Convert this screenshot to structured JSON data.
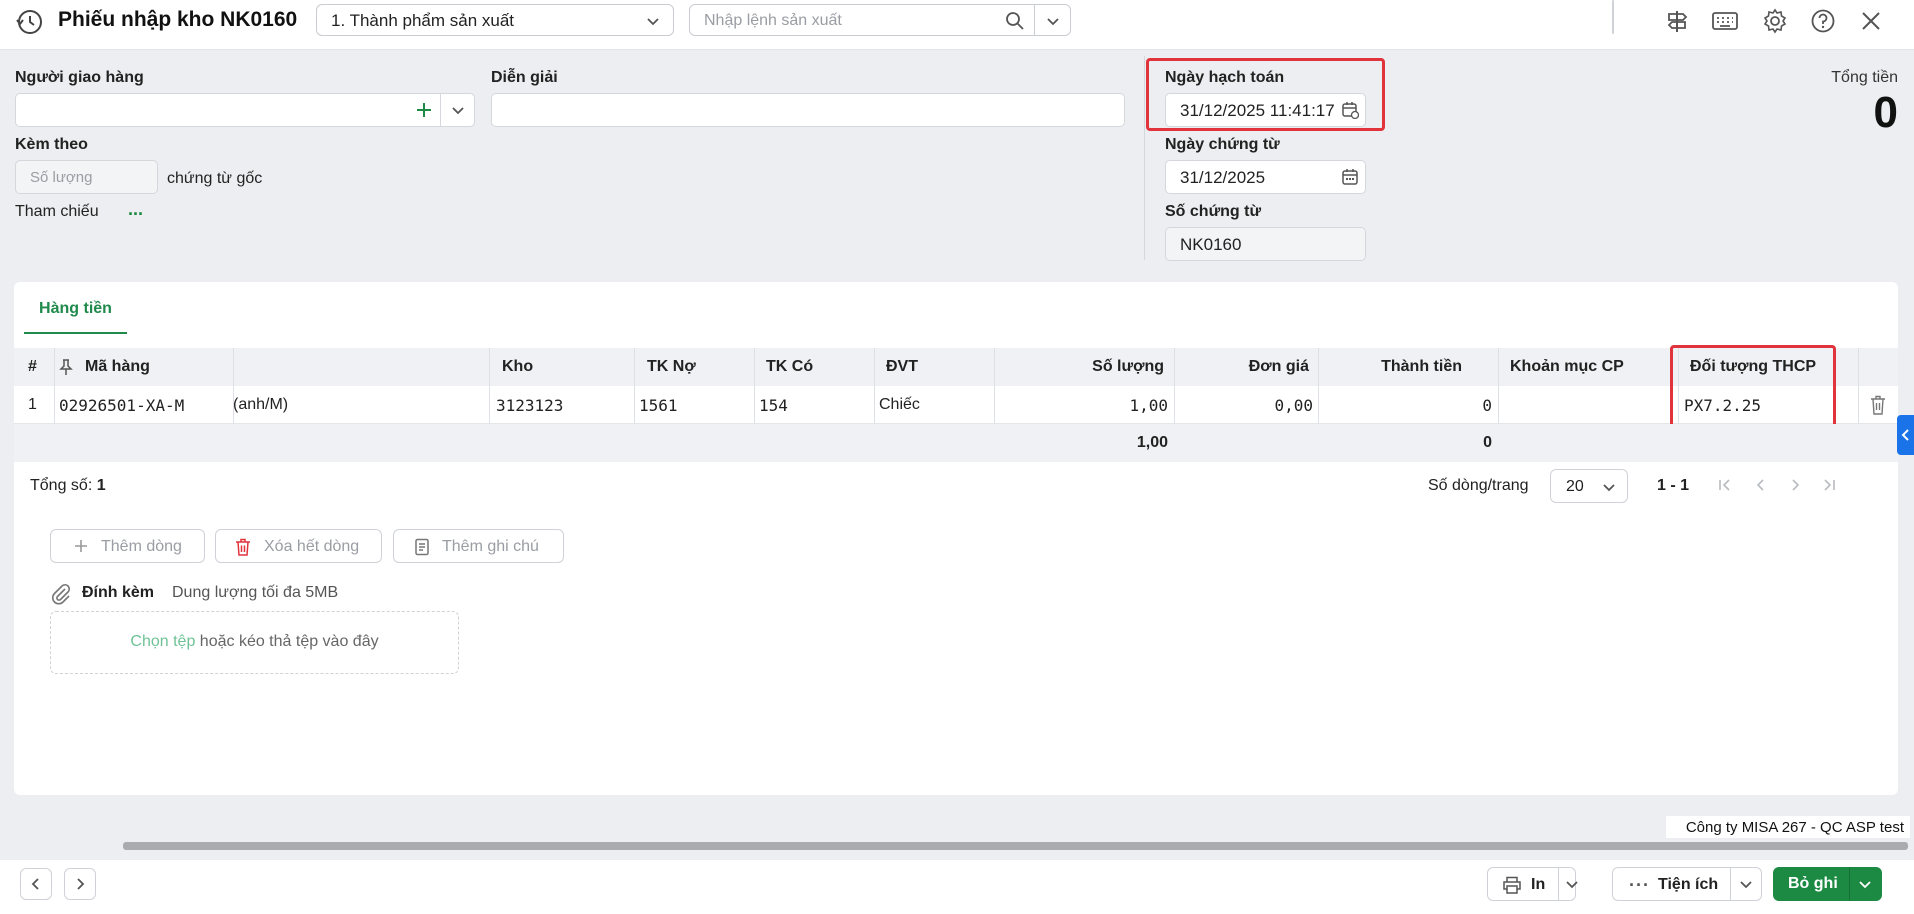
{
  "header": {
    "title": "Phiếu nhập kho NK0160",
    "type_select": "1. Thành phẩm sản xuất",
    "production_placeholder": "Nhập lệnh sản xuất"
  },
  "form": {
    "nguoi_giao_hang_label": "Người giao hàng",
    "nguoi_giao_hang_value": "",
    "dien_giai_label": "Diễn giải",
    "dien_giai_value": "",
    "kem_theo_label": "Kèm theo",
    "so_luong_placeholder": "Số lượng",
    "chung_tu_goc": "chứng từ gốc",
    "tham_chieu_label": "Tham chiếu",
    "tham_chieu_link": "...",
    "ngay_hach_toan_label": "Ngày hạch toán",
    "ngay_hach_toan_value": "31/12/2025 11:41:17",
    "ngay_chung_tu_label": "Ngày chứng từ",
    "ngay_chung_tu_value": "31/12/2025",
    "so_chung_tu_label": "Số chứng từ",
    "so_chung_tu_value": "NK0160",
    "tong_tien_label": "Tổng tiền",
    "tong_tien_value": "0"
  },
  "tabs": [
    {
      "label": "Hàng tiền"
    }
  ],
  "table": {
    "headers": {
      "num": "#",
      "ma_hang": "Mã hàng",
      "kho": "Kho",
      "tk_no": "TK Nợ",
      "tk_co": "TK Có",
      "dvt": "ĐVT",
      "so_luong": "Số lượng",
      "don_gia": "Đơn giá",
      "thanh_tien": "Thành tiền",
      "khoan_muc_cp": "Khoản mục CP",
      "doi_tuong_thcp": "Đối tượng THCP"
    },
    "rows": [
      {
        "num": "1",
        "ma_hang": "02926501-XA-M",
        "ten_hang": "(anh/M)",
        "kho": "3123123",
        "tk_no": "1561",
        "tk_co": "154",
        "dvt": "Chiếc",
        "so_luong": "1,00",
        "don_gia": "0,00",
        "thanh_tien": "0",
        "khoan_muc_cp": "",
        "doi_tuong_thcp": "PX7.2.25"
      }
    ],
    "totals": {
      "so_luong": "1,00",
      "thanh_tien": "0"
    }
  },
  "pagination": {
    "tong_so_label": "Tổng số:",
    "tong_so_value": "1",
    "rows_per_page_label": "Số dòng/trang",
    "rows_per_page_value": "20",
    "range": "1 - 1"
  },
  "actions": {
    "them_dong": "Thêm dòng",
    "xoa_het_dong": "Xóa hết dòng",
    "them_ghi_chu": "Thêm ghi chú"
  },
  "attach": {
    "label": "Đính kèm",
    "limit": "Dung lượng tối đa 5MB",
    "choose": "Chọn tệp",
    "drop_text": "hoặc kéo thả tệp vào đây"
  },
  "company": "Công ty MISA 267 - QC ASP test",
  "footer": {
    "in_label": "In",
    "tien_ich_label": "Tiện ích",
    "bo_ghi_label": "Bỏ ghi"
  },
  "colors": {
    "accent_green": "#1c8a43",
    "highlight_red": "#e0333b",
    "side_tab_blue": "#1a73e8"
  }
}
